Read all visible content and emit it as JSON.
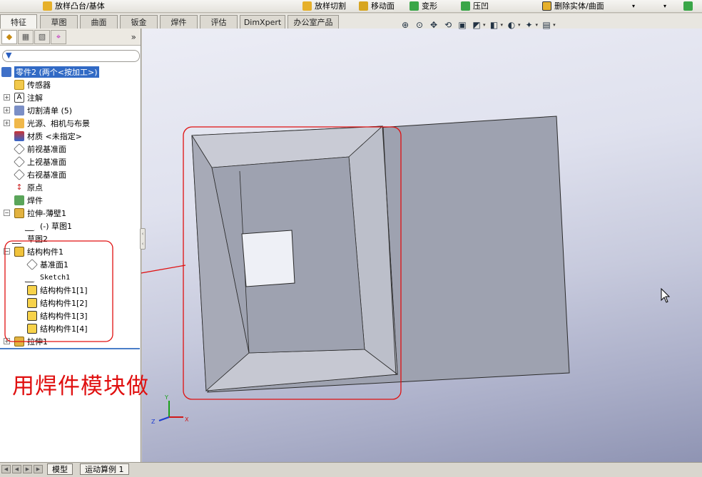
{
  "command_bar": {
    "items": [
      {
        "label": "放样凸台/基体",
        "icon": "loft-boss-icon",
        "color": "#e6b02a"
      },
      {
        "label": "放样切割",
        "icon": "loft-cut-icon",
        "color": "#e6b02a"
      },
      {
        "label": "移动面",
        "icon": "move-face-icon",
        "color": "#d7a520"
      },
      {
        "label": "变形",
        "icon": "deform-icon",
        "color": "#3aa648"
      },
      {
        "label": "压凹",
        "icon": "indent-icon",
        "color": "#3aa648"
      },
      {
        "label": "删除实体/曲面",
        "icon": "delete-body-icon",
        "color": "#e6b02a"
      }
    ]
  },
  "tabs": [
    "特征",
    "草图",
    "曲面",
    "钣金",
    "焊件",
    "评估",
    "DimXpert",
    "办公室产品"
  ],
  "active_tab": "特征",
  "view_toolbar": [
    "zoom-to-fit-icon",
    "zoom-area-icon",
    "pan-icon",
    "rotate-icon",
    "section-view-icon",
    "view-orientation-icon",
    "display-style-icon",
    "hide-show-icon",
    "edit-appearance-icon",
    "apply-scene-icon"
  ],
  "panel_tabs": [
    "feature-manager-icon",
    "property-manager-icon",
    "configuration-manager-icon",
    "dimxpert-manager-icon"
  ],
  "tree": {
    "root": "零件2  (两个<按加工>)",
    "items": [
      {
        "label": "传感器",
        "icon": "sensor-icon"
      },
      {
        "label": "注解",
        "icon": "annotations-icon"
      },
      {
        "label": "切割清单 (5)",
        "icon": "cut-list-icon"
      },
      {
        "label": "光源、相机与布景",
        "icon": "lights-icon"
      },
      {
        "label": "材质 <未指定>",
        "icon": "material-icon"
      },
      {
        "label": "前视基准面",
        "icon": "plane-icon"
      },
      {
        "label": "上视基准面",
        "icon": "plane-icon"
      },
      {
        "label": "右视基准面",
        "icon": "plane-icon"
      },
      {
        "label": "原点",
        "icon": "origin-icon"
      },
      {
        "label": "焊件",
        "icon": "weldment-icon"
      },
      {
        "label": "拉伸-薄壁1",
        "icon": "extrude-icon"
      },
      {
        "label": "(-) 草图1",
        "icon": "sketch-icon"
      },
      {
        "label": "草图2",
        "icon": "sketch-icon"
      },
      {
        "label": "结构构件1",
        "icon": "structural-member-icon"
      },
      {
        "label": "基准面1",
        "icon": "plane-icon"
      },
      {
        "label": "Sketch1",
        "icon": "sketch-icon"
      },
      {
        "label": "结构构件1[1]",
        "icon": "member-body-icon"
      },
      {
        "label": "结构构件1[2]",
        "icon": "member-body-icon"
      },
      {
        "label": "结构构件1[3]",
        "icon": "member-body-icon"
      },
      {
        "label": "结构构件1[4]",
        "icon": "member-body-icon"
      },
      {
        "label": "拉伸1",
        "icon": "extrude-icon"
      }
    ]
  },
  "annotation_note": "用焊件模块做",
  "bottom_tabs": [
    "模型",
    "运动算例 1"
  ],
  "colors": {
    "annotation_red": "#e01010",
    "selection_blue": "#316ac5",
    "plate_face": "#9a9fad"
  },
  "triad_axes": [
    "Y",
    "X",
    "Z"
  ]
}
